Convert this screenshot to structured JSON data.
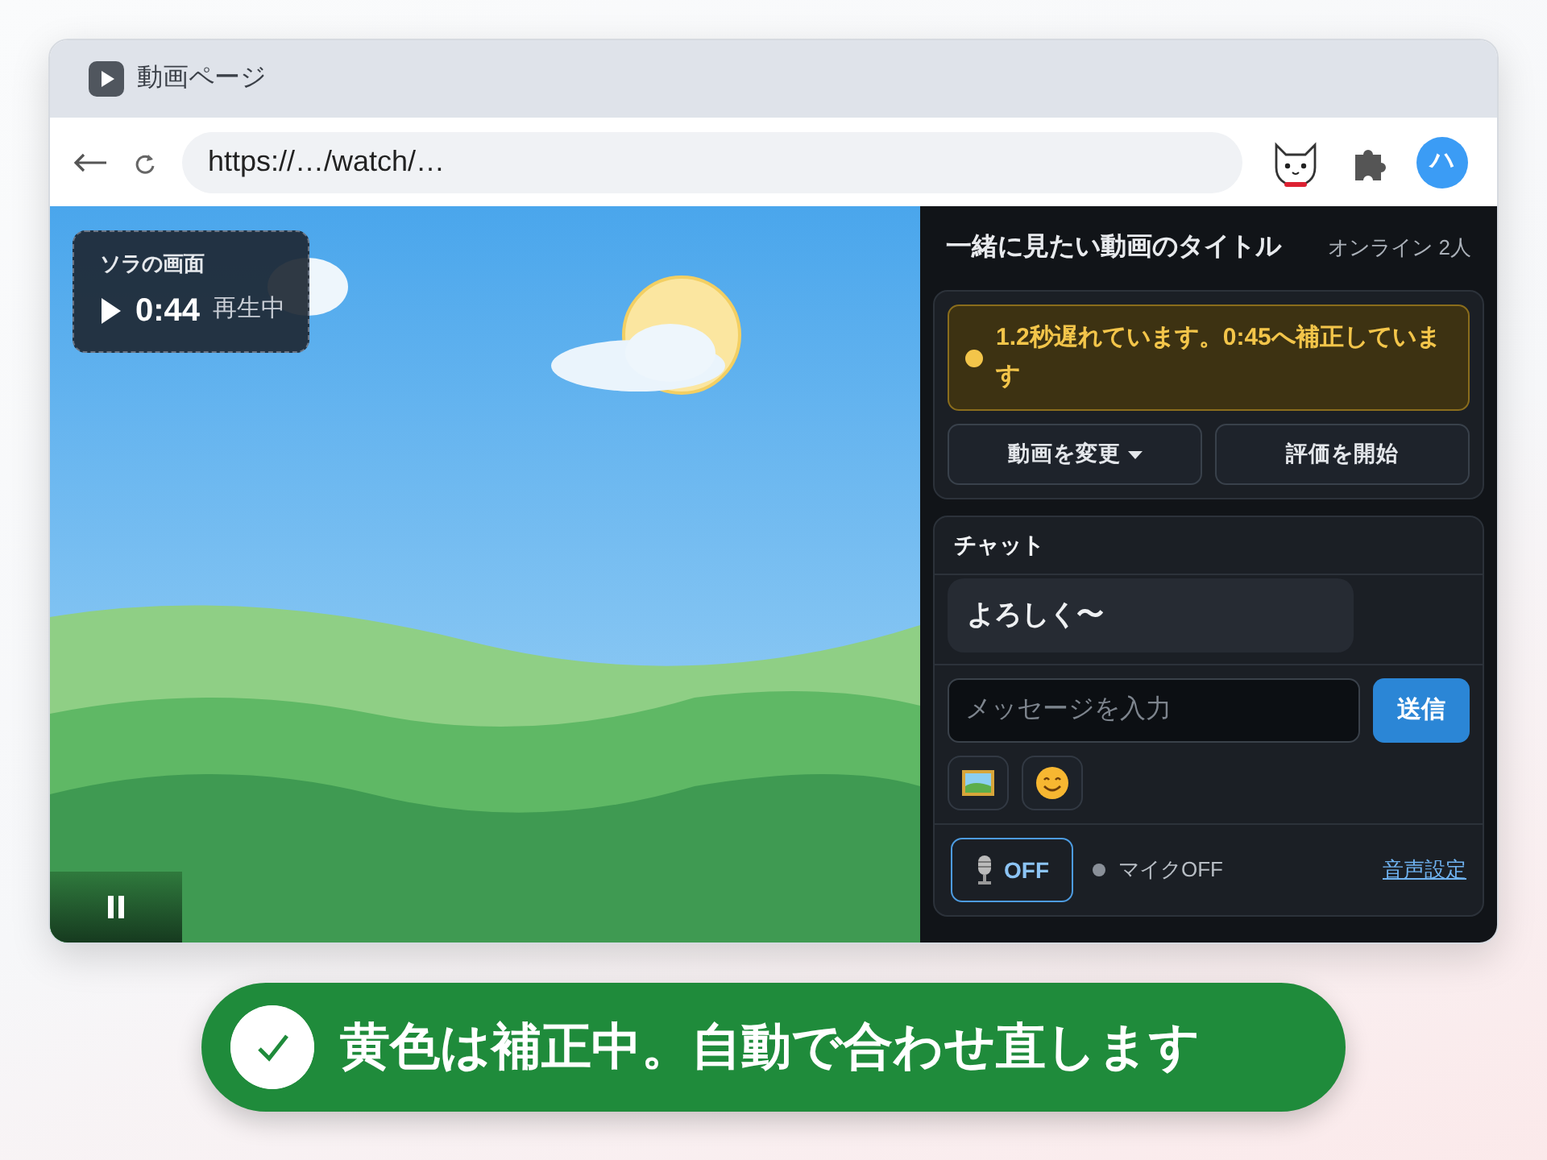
{
  "window": {
    "tab_title": "動画ページ",
    "url": "https://…/watch/…",
    "avatar_initial": "ハ"
  },
  "video": {
    "playing": true,
    "overlay": {
      "label": "ソラの画面",
      "time": "0:44",
      "status": "再生中"
    }
  },
  "sidebar": {
    "title": "一緒に見たい動画のタイトル",
    "online": "オンライン 2人",
    "sync_notice": {
      "kind": "warning",
      "text": "1.2秒遅れています。0:45へ補正しています"
    },
    "buttons": [
      {
        "label": "動画を変更",
        "dropdown": true
      },
      {
        "label": "評価を開始",
        "dropdown": false
      }
    ]
  },
  "chat": {
    "title": "チャット",
    "messages": [
      {
        "text": "よろしく〜"
      }
    ],
    "input": {
      "placeholder": "メッセージを入力"
    },
    "send_label": "送信"
  },
  "voice": {
    "mic_on": false,
    "button_label": "OFF",
    "status": "マイクOFF",
    "settings_link": "音声設定"
  },
  "banner": {
    "text": "黄色は補正中。自動で合わせ直します"
  }
}
